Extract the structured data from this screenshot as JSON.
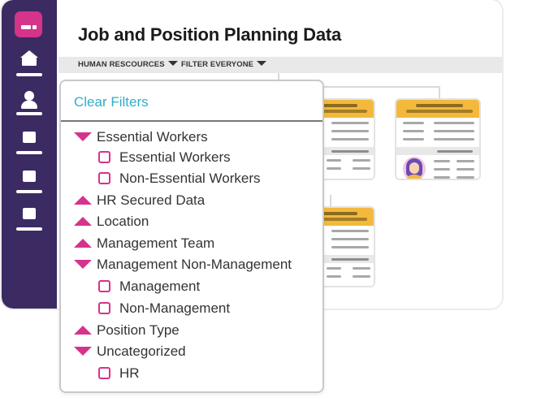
{
  "app": {
    "title": "Job and Position Planning Data",
    "brand_color": "#3c2a63",
    "accent_color": "#d6338a",
    "link_color": "#2eaec7",
    "card_header_color": "#f3b93d"
  },
  "sidebar": {
    "items": [
      {
        "icon": "logo-icon"
      },
      {
        "icon": "home-icon"
      },
      {
        "icon": "user-icon"
      },
      {
        "icon": "document-icon"
      },
      {
        "icon": "document-icon"
      },
      {
        "icon": "document-icon"
      }
    ]
  },
  "filter_bar": {
    "chips": [
      {
        "label": "HUMAN RESCOURCES"
      },
      {
        "label": "FILTER EVERYONE"
      }
    ]
  },
  "filter_panel": {
    "clear_label": "Clear Filters",
    "groups": [
      {
        "label": "Essential Workers",
        "state": "expanded",
        "options": [
          {
            "label": "Essential Workers"
          },
          {
            "label": "Non-Essential Workers"
          }
        ]
      },
      {
        "label": "HR Secured Data",
        "state": "collapsed"
      },
      {
        "label": "Location",
        "state": "collapsed"
      },
      {
        "label": "Management Team",
        "state": "collapsed"
      },
      {
        "label": "Management Non-Management",
        "state": "expanded",
        "options": [
          {
            "label": "Management"
          },
          {
            "label": "Non-Management"
          }
        ]
      },
      {
        "label": "Position Type",
        "state": "collapsed"
      },
      {
        "label": "Uncategorized",
        "state": "expanded",
        "options": [
          {
            "label": "HR"
          }
        ]
      }
    ]
  }
}
